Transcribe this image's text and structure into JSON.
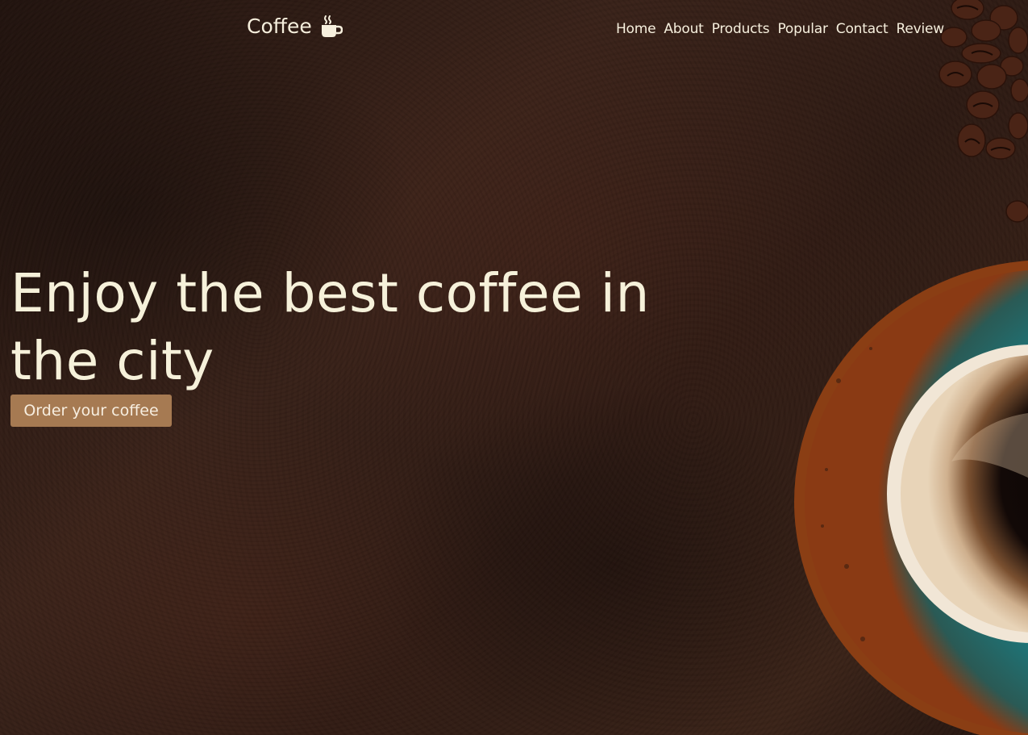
{
  "header": {
    "logo_text": "Coffee",
    "logo_icon": "mug-hot-icon",
    "nav": [
      {
        "label": "Home"
      },
      {
        "label": "About"
      },
      {
        "label": "Products"
      },
      {
        "label": "Popular"
      },
      {
        "label": "Contact"
      },
      {
        "label": "Review"
      }
    ]
  },
  "hero": {
    "headline": "Enjoy the best coffee in the city",
    "cta_label": "Order your coffee"
  },
  "colors": {
    "text": "#f6f1da",
    "accent": "#a67a52",
    "background": "#2e1b14",
    "saucer": "#1c6b6b"
  }
}
